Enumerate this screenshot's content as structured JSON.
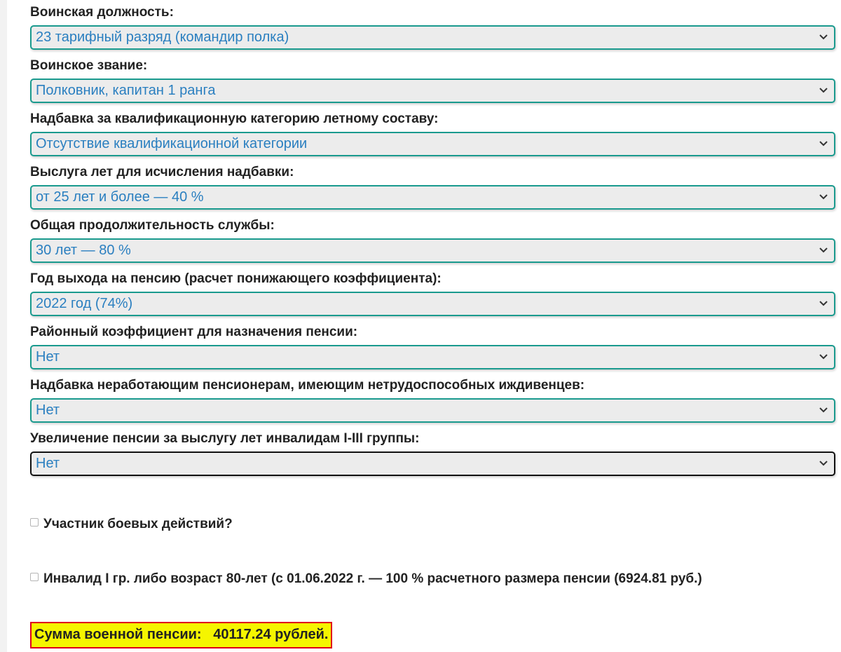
{
  "fields": [
    {
      "label": "Воинская должность:",
      "value": "23 тарифный разряд (командир полка)"
    },
    {
      "label": "Воинское звание:",
      "value": "Полковник, капитан 1 ранга"
    },
    {
      "label": "Надбавка за квалификационную категорию летному составу:",
      "value": "Отсутствие квалификационной категории"
    },
    {
      "label": "Выслуга лет для исчисления надбавки:",
      "value": "от 25 лет и более — 40 %"
    },
    {
      "label": "Общая продолжительность службы:",
      "value": "30 лет — 80 %"
    },
    {
      "label": "Год выхода на пенсию (расчет понижающего коэффициента):",
      "value": "2022 год (74%)"
    },
    {
      "label": "Районный коэффициент для назначения пенсии:",
      "value": "Нет"
    },
    {
      "label": "Надбавка неработающим пенсионерам, имеющим нетрудоспособных иждивенцев:",
      "value": "Нет"
    },
    {
      "label": "Увеличение пенсии за выслугу лет инвалидам I-III группы:",
      "value": "Нет"
    }
  ],
  "checkboxes": [
    {
      "label": "Участник боевых действий?",
      "checked": false
    },
    {
      "label": "Инвалид I гр. либо возраст 80-лет (с 01.06.2022 г. — 100 % расчетного размера пенсии (6924.81 руб.)",
      "checked": false
    }
  ],
  "result": {
    "label": "Сумма военной пенсии:",
    "amount": "40117.24 рублей."
  },
  "icons": {
    "dropdown": "chevron-down-icon"
  },
  "colors": {
    "select_border": "#1a9a8e",
    "select_border_focused": "#111111",
    "select_text": "#2a7fc0",
    "select_bg": "#ececec",
    "result_bg": "#f5f500",
    "result_border": "#e0001b"
  }
}
